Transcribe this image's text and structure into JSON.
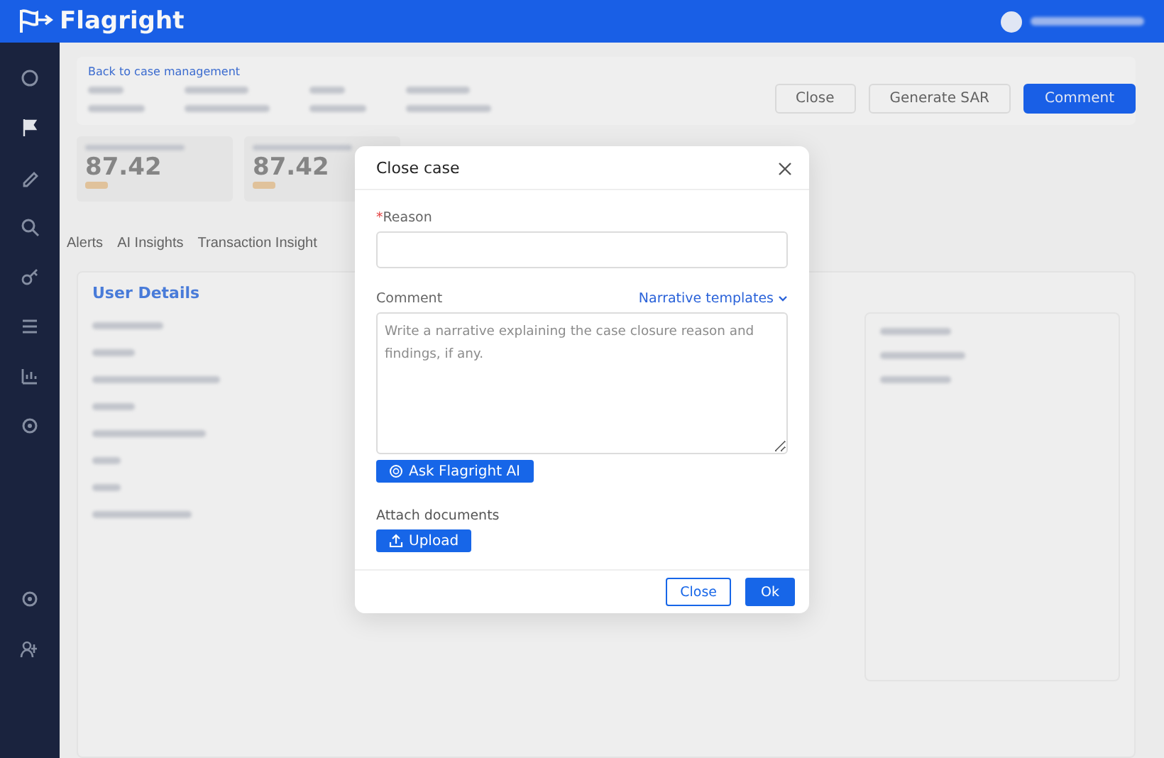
{
  "topbar": {
    "brand": "Flagright"
  },
  "case_header": {
    "back_link": "Back to case management",
    "actions": [
      {
        "label": "Close",
        "kind": "default"
      },
      {
        "label": "Generate SAR",
        "kind": "default"
      },
      {
        "label": "Comment",
        "kind": "primary"
      }
    ]
  },
  "score_cards": [
    {
      "value": "87.42"
    },
    {
      "value": "87.42"
    }
  ],
  "tabs": [
    {
      "label": "Alerts"
    },
    {
      "label": "AI Insights"
    },
    {
      "label": "Transaction Insight"
    }
  ],
  "user_details": {
    "title": "User Details"
  },
  "dialog": {
    "title": "Close case",
    "fields": [
      {
        "kind": "input",
        "label": "Reason",
        "required_mark": "*"
      },
      {
        "kind": "textarea",
        "label": "Comment",
        "link": "Narrative templates",
        "placeholder": "Write a narrative explaining the case closure reason and findings, if any."
      }
    ],
    "ai_button": "Ask Flagright AI",
    "attach_label": "Attach documents",
    "upload_button": "Upload",
    "buttons": [
      {
        "label": "Close",
        "kind": "default"
      },
      {
        "label": "Ok",
        "kind": "primary"
      }
    ]
  }
}
